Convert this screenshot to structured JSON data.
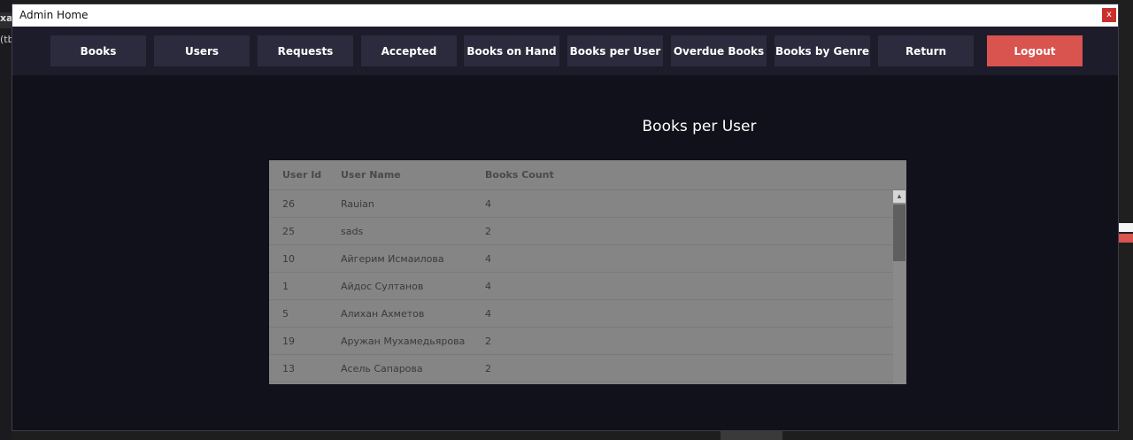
{
  "window": {
    "title": "Admin Home",
    "close_label": "x"
  },
  "background": {
    "tab_text": "xam",
    "tab2_text": "(tb"
  },
  "nav": {
    "items": [
      {
        "label": "Books"
      },
      {
        "label": "Users"
      },
      {
        "label": "Requests"
      },
      {
        "label": "Accepted"
      },
      {
        "label": "Books on Hand"
      },
      {
        "label": "Books per User"
      },
      {
        "label": "Overdue Books"
      },
      {
        "label": "Books by Genre"
      },
      {
        "label": "Return"
      },
      {
        "label": "Logout"
      }
    ]
  },
  "page": {
    "title": "Books per User"
  },
  "table": {
    "columns": [
      "User Id",
      "User Name",
      "Books Count"
    ],
    "rows": [
      {
        "id": "26",
        "name": "Rauian",
        "count": "4"
      },
      {
        "id": "25",
        "name": "sads",
        "count": "2"
      },
      {
        "id": "10",
        "name": "Айгерим Исмаилова",
        "count": "4"
      },
      {
        "id": "1",
        "name": "Айдос Султанов",
        "count": "4"
      },
      {
        "id": "5",
        "name": "Алихан Ахметов",
        "count": "4"
      },
      {
        "id": "19",
        "name": "Аружан Мухамедьярова",
        "count": "2"
      },
      {
        "id": "13",
        "name": "Асель Сапарова",
        "count": "2"
      }
    ]
  },
  "colors": {
    "window_bg": "#10111a",
    "navbar_bg": "#1d1c2b",
    "nav_button_bg": "#2c2b3d",
    "logout_bg": "#d9534f",
    "grid_bg": "#858585"
  }
}
